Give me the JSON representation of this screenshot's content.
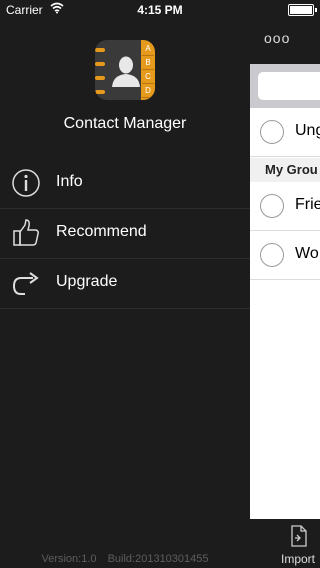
{
  "status_bar": {
    "carrier": "Carrier",
    "time": "4:15 PM"
  },
  "app": {
    "title": "Contact Manager",
    "icon_letters": [
      "A",
      "B",
      "C",
      "D"
    ]
  },
  "menu": {
    "items": [
      {
        "label": "Info",
        "icon": "info-icon"
      },
      {
        "label": "Recommend",
        "icon": "thumbs-up-icon"
      },
      {
        "label": "Upgrade",
        "icon": "upgrade-arrow-icon"
      }
    ]
  },
  "footer": {
    "version": "Version:1.0",
    "build": "Build:201310301455"
  },
  "panel": {
    "more_label": "ooo",
    "rows": [
      {
        "label": "Ung"
      },
      {
        "label": "Frie"
      },
      {
        "label": "Wo"
      }
    ],
    "section_header": "My Grou",
    "tab_label": "Import"
  },
  "colors": {
    "accent": "#e69a1c",
    "menu_bg": "#1c1c1c"
  }
}
